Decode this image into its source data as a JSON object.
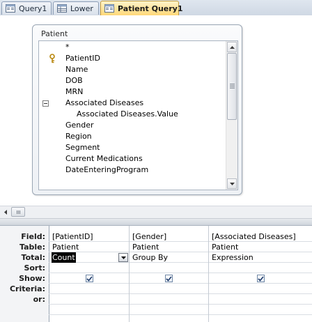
{
  "tabs": [
    {
      "label": "Query1",
      "icon": "query-icon",
      "active": false
    },
    {
      "label": "Lower",
      "icon": "table-icon",
      "active": false
    },
    {
      "label": "Patient Query1",
      "icon": "query-icon",
      "active": true
    }
  ],
  "table_box": {
    "title": "Patient",
    "fields": [
      {
        "label": "*",
        "indent": 0,
        "key": false,
        "collapse": false
      },
      {
        "label": "PatientID",
        "indent": 0,
        "key": true,
        "collapse": false
      },
      {
        "label": "Name",
        "indent": 0,
        "key": false,
        "collapse": false
      },
      {
        "label": "DOB",
        "indent": 0,
        "key": false,
        "collapse": false
      },
      {
        "label": "MRN",
        "indent": 0,
        "key": false,
        "collapse": false
      },
      {
        "label": "Associated Diseases",
        "indent": 0,
        "key": false,
        "collapse": true
      },
      {
        "label": "Associated Diseases.Value",
        "indent": 1,
        "key": false,
        "collapse": false
      },
      {
        "label": "Gender",
        "indent": 0,
        "key": false,
        "collapse": false
      },
      {
        "label": "Region",
        "indent": 0,
        "key": false,
        "collapse": false
      },
      {
        "label": "Segment",
        "indent": 0,
        "key": false,
        "collapse": false
      },
      {
        "label": "Current Medications",
        "indent": 0,
        "key": false,
        "collapse": false
      },
      {
        "label": "DateEnteringProgram",
        "indent": 0,
        "key": false,
        "collapse": false
      }
    ]
  },
  "grid": {
    "row_labels": [
      "Field:",
      "Table:",
      "Total:",
      "Sort:",
      "Show:",
      "Criteria:",
      "or:"
    ],
    "columns": [
      {
        "field": "[PatientID]",
        "table": "Patient",
        "total": "Count",
        "sort": "",
        "show": true,
        "criteria": "",
        "or": ""
      },
      {
        "field": "[Gender]",
        "table": "Patient",
        "total": "Group By",
        "sort": "",
        "show": true,
        "criteria": "",
        "or": ""
      },
      {
        "field": "[Associated Diseases]",
        "table": "Patient",
        "total": "Expression",
        "sort": "",
        "show": true,
        "criteria": "",
        "or": ""
      }
    ]
  },
  "colors": {
    "active_tab": "#ffd879",
    "checkbox_check": "#1f3b6b",
    "selection": "#000000"
  }
}
